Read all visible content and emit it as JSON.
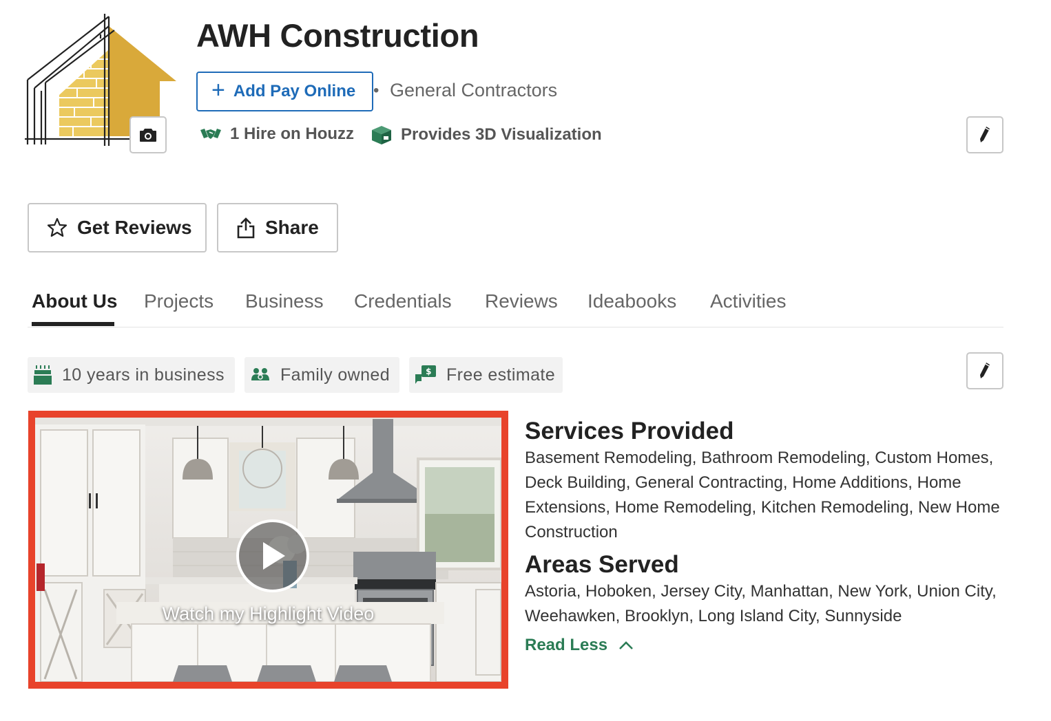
{
  "header": {
    "company_name": "AWH Construction",
    "pay_online_label": "Add Pay Online",
    "separator": "•",
    "category": "General Contractors",
    "hires": "1 Hire on Houzz",
    "visualization": "Provides 3D Visualization"
  },
  "actions": {
    "get_reviews": "Get Reviews",
    "share": "Share"
  },
  "tabs": [
    {
      "label": "About Us",
      "active": true
    },
    {
      "label": "Projects",
      "active": false
    },
    {
      "label": "Business",
      "active": false
    },
    {
      "label": "Credentials",
      "active": false
    },
    {
      "label": "Reviews",
      "active": false
    },
    {
      "label": "Ideabooks",
      "active": false
    },
    {
      "label": "Activities",
      "active": false
    }
  ],
  "highlights": [
    {
      "icon": "cake-icon",
      "label": "10 years in business"
    },
    {
      "icon": "family-icon",
      "label": "Family owned"
    },
    {
      "icon": "estimate-icon",
      "label": "Free estimate"
    }
  ],
  "video": {
    "caption": "Watch my Highlight Video"
  },
  "services": {
    "title": "Services Provided",
    "text": "Basement Remodeling, Bathroom Remodeling, Custom Homes, Deck Building, General Contracting, Home Additions, Home Extensions, Home Remodeling, Kitchen Remodeling, New Home Construction"
  },
  "areas": {
    "title": "Areas Served",
    "text": "Astoria, Hoboken, Jersey City, Manhattan, New York, Union City, Weehawken, Brooklyn, Long Island City, Sunnyside"
  },
  "read_less": "Read Less",
  "colors": {
    "link_blue": "#1e6bb8",
    "accent_green": "#2b7c55",
    "video_border": "#e8432b",
    "logo_gold": "#d9a93a"
  }
}
